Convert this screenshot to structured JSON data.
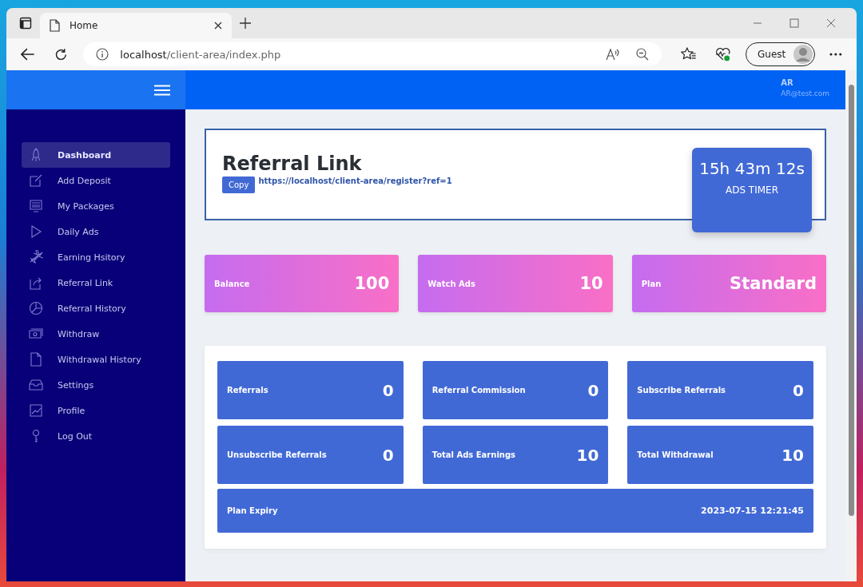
{
  "browser": {
    "tab_title": "Home",
    "url_host": "localhost",
    "url_path": "/client-area/index.php",
    "profile": "Guest"
  },
  "header": {
    "user_name": "AR",
    "user_email": "AR@test.com"
  },
  "sidebar": {
    "items": [
      {
        "label": "Dashboard",
        "selected": true
      },
      {
        "label": "Add Deposit",
        "selected": false
      },
      {
        "label": "My Packages",
        "selected": false
      },
      {
        "label": "Daily Ads",
        "selected": false
      },
      {
        "label": "Earning Hsitory",
        "selected": false
      },
      {
        "label": "Referral Link",
        "selected": false
      },
      {
        "label": "Referral History",
        "selected": false
      },
      {
        "label": "Withdraw",
        "selected": false
      },
      {
        "label": "Withdrawal History",
        "selected": false
      },
      {
        "label": "Settings",
        "selected": false
      },
      {
        "label": "Profile",
        "selected": false
      },
      {
        "label": "Log Out",
        "selected": false
      }
    ]
  },
  "referral": {
    "title": "Referral Link",
    "copy_button": "Copy",
    "link": "https://localhost/client-area/register?ref=1"
  },
  "timer": {
    "value": "15h 43m 12s",
    "label": "ADS TIMER"
  },
  "summary_cards": [
    {
      "label": "Balance",
      "value": "100"
    },
    {
      "label": "Watch Ads",
      "value": "10"
    },
    {
      "label": "Plan",
      "value": "Standard"
    }
  ],
  "stats": [
    {
      "label": "Referrals",
      "value": "0"
    },
    {
      "label": "Referral Commission",
      "value": "0"
    },
    {
      "label": "Subscribe Referrals",
      "value": "0"
    },
    {
      "label": "Unsubscribe Referrals",
      "value": "0"
    },
    {
      "label": "Total Ads Earnings",
      "value": "10"
    },
    {
      "label": "Total Withdrawal",
      "value": "10"
    }
  ],
  "plan_expiry": {
    "label": "Plan Expiry",
    "value": "2023-07-15 12:21:45"
  }
}
